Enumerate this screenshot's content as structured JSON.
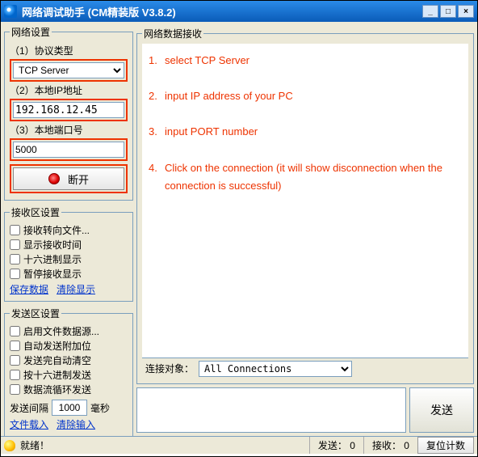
{
  "window": {
    "title": "网络调试助手 (CM精装版 V3.8.2)"
  },
  "left": {
    "net_settings_legend": "网络设置",
    "protocol_label": "（1）协议类型",
    "protocol_value": "TCP Server",
    "ip_label": "（2）本地IP地址",
    "ip_value": "192.168.12.45",
    "port_label": "（3）本地端口号",
    "port_value": "5000",
    "disconnect_label": "断开",
    "recv_settings_legend": "接收区设置",
    "recv_checks": [
      "接收转向文件...",
      "显示接收时间",
      "十六进制显示",
      "暂停接收显示"
    ],
    "recv_links": {
      "save": "保存数据",
      "clear": "清除显示"
    },
    "send_settings_legend": "发送区设置",
    "send_checks": [
      "启用文件数据源...",
      "自动发送附加位",
      "发送完自动清空",
      "按十六进制发送",
      "数据流循环发送"
    ],
    "send_interval_label": "发送间隔",
    "send_interval_value": "1000",
    "send_interval_unit": "毫秒",
    "send_links": {
      "load": "文件载入",
      "clear": "清除输入"
    }
  },
  "right": {
    "recv_legend": "网络数据接收",
    "instructions": [
      {
        "n": "1.",
        "text": "select TCP Server"
      },
      {
        "n": "2.",
        "text": "input IP address of your PC"
      },
      {
        "n": "3.",
        "text": "input PORT number"
      },
      {
        "n": "4.",
        "text": "Click on the connection (it will show disconnection when the connection is successful)"
      }
    ],
    "target_label": "连接对象：",
    "target_value": "All Connections",
    "send_button": "发送"
  },
  "status": {
    "ready": "就绪！",
    "sent_label": "发送：",
    "sent_value": "0",
    "recv_label": "接收：",
    "recv_value": "0",
    "reset": "复位计数"
  }
}
